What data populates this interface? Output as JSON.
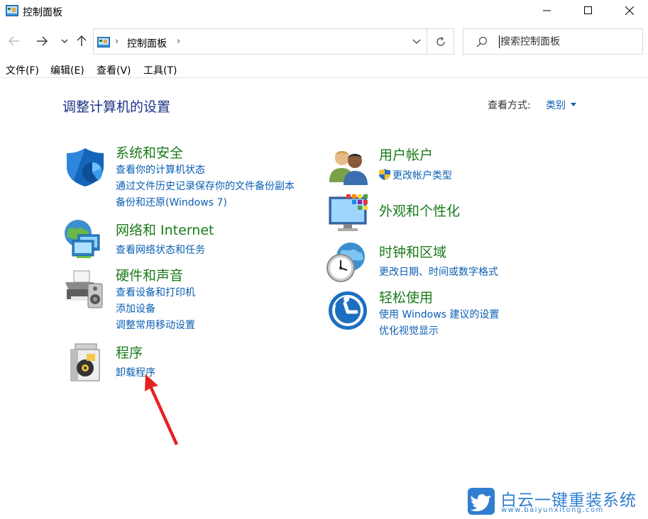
{
  "window": {
    "title": "控制面板"
  },
  "address_bar": {
    "crumb": "控制面板",
    "separator": "›"
  },
  "search": {
    "placeholder": "搜索控制面板"
  },
  "menu": {
    "file": "文件(F)",
    "edit": "编辑(E)",
    "view": "查看(V)",
    "tools": "工具(T)"
  },
  "main": {
    "title": "调整计算机的设置",
    "view_by_label": "查看方式:",
    "view_by_value": "类别"
  },
  "categories": {
    "system_security": {
      "title": "系统和安全",
      "links": [
        "查看你的计算机状态",
        "通过文件历史记录保存你的文件备份副本",
        "备份和还原(Windows 7)"
      ]
    },
    "network": {
      "title": "网络和 Internet",
      "links": [
        "查看网络状态和任务"
      ]
    },
    "hardware": {
      "title": "硬件和声音",
      "links": [
        "查看设备和打印机",
        "添加设备",
        "调整常用移动设置"
      ]
    },
    "programs": {
      "title": "程序",
      "links": [
        "卸载程序"
      ]
    },
    "user_accounts": {
      "title": "用户帐户",
      "links": [
        "更改帐户类型"
      ]
    },
    "appearance": {
      "title": "外观和个性化",
      "links": []
    },
    "clock_region": {
      "title": "时钟和区域",
      "links": [
        "更改日期、时间或数字格式"
      ]
    },
    "ease_of_access": {
      "title": "轻松使用",
      "links": [
        "使用 Windows 建议的设置",
        "优化视觉显示"
      ]
    }
  },
  "watermark": {
    "title": "白云一键重装系统",
    "url": "www.baiyunxitong.com"
  },
  "colors": {
    "category_title": "#1b7a1b",
    "link": "#0b5fb3",
    "page_title": "#1e3287",
    "annotation_arrow": "#e52222",
    "watermark": "#2f7ed0"
  }
}
